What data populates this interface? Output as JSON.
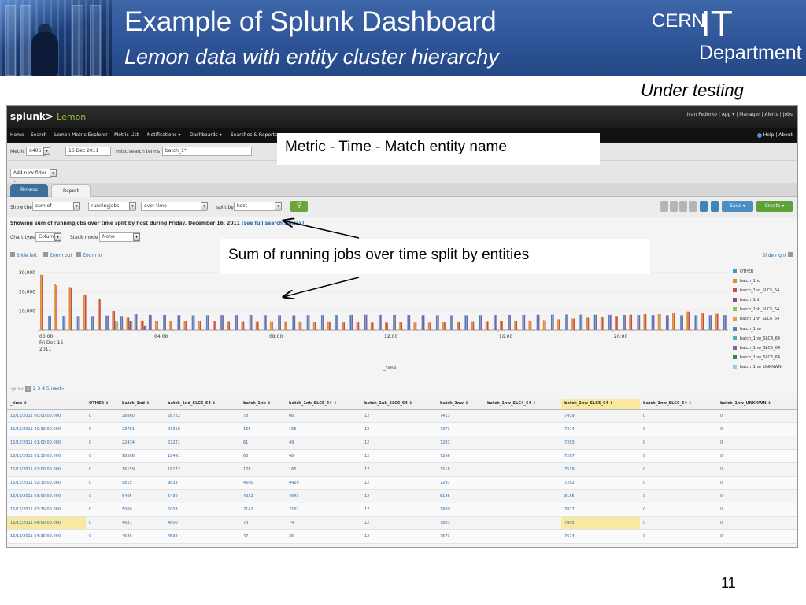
{
  "slide": {
    "title": "Example of Splunk Dashboard",
    "subtitle": "Lemon data with entity cluster hierarchy",
    "logo": {
      "cern": "CERN",
      "it": "IT",
      "dept": "Department"
    },
    "note": "Under testing",
    "page_number": "11"
  },
  "callouts": {
    "metric": "Metric - Time - Match entity name",
    "sum": "Sum of running jobs over time split by entities"
  },
  "app": {
    "brand": "splunk>",
    "app_name": "Lemon",
    "user_links": "Ivan Fedorko | App ▾ | Manager | Alerts | Jobs",
    "menu": [
      "Home",
      "Search",
      "Lemon Metric Explorer",
      "Metric List",
      "Notifications ▾",
      "Dashboards ▾",
      "Searches & Reports"
    ],
    "help_links": "Help | About",
    "search": {
      "metric_label": "Metric",
      "metric_value": "6406",
      "date_value": "16 Dec 2011",
      "misc_label": "misc search terms",
      "misc_value": "batch_1*"
    },
    "filter_button": "Add new filter ...",
    "tabs": {
      "browse": "Browse",
      "report": "Report"
    },
    "report": {
      "show_the_label": "Show the",
      "aggregate": "sum of",
      "field": "runningjobs",
      "over": "over time",
      "split_label": "split by",
      "split_value": "host",
      "save_label": "Save ▾",
      "create_label": "Create ▾"
    },
    "summary": "Showing sum of runningjobs over time split by host during Friday, December 16, 2011",
    "summary_link": "(see full search syntax)",
    "chart_type_label": "Chart type",
    "chart_type_value": "Column",
    "stack_mode_label": "Stack mode",
    "stack_mode_value": "None",
    "slide_left": "Slide left",
    "zoom_out": "Zoom out",
    "zoom_in": "Zoom in",
    "slide_right": "Slide right",
    "pager": {
      "prev": "«prev",
      "pages": [
        "1",
        "2",
        "3",
        "4",
        "5"
      ],
      "next": "next»"
    },
    "colors": {
      "topbar": "#1c1c1c",
      "accent": "#8fc33f",
      "link": "#2a6aa8",
      "tab": "#3e6e9c",
      "highlight": "#f8e8a0"
    }
  },
  "chart_data": {
    "type": "bar",
    "xlabel": "_time",
    "ylim": [
      0,
      32000
    ],
    "y_ticks": [
      "30,000",
      "20,000",
      "10,000"
    ],
    "y_tick_values": [
      30000,
      20000,
      10000
    ],
    "x_tick_labels": [
      {
        "label": "00:00",
        "sub": [
          "Fri Dec 16",
          "2011"
        ],
        "slot": 0
      },
      {
        "label": "04:00",
        "sub": [],
        "slot": 8
      },
      {
        "label": "08:00",
        "sub": [],
        "slot": 16
      },
      {
        "label": "12:00",
        "sub": [],
        "slot": 24
      },
      {
        "label": "16:00",
        "sub": [],
        "slot": 32
      },
      {
        "label": "20:00",
        "sub": [],
        "slot": 40
      }
    ],
    "slots": 48,
    "series": [
      {
        "name": "OTHER",
        "color": "#3f9fc0",
        "values": [
          0,
          0,
          0,
          0,
          0,
          0,
          0,
          0,
          0,
          0,
          0,
          0,
          0,
          0,
          0,
          0,
          0,
          0,
          0,
          0,
          0,
          0,
          0,
          0,
          0,
          0,
          0,
          0,
          0,
          0,
          0,
          0,
          0,
          0,
          0,
          0,
          0,
          0,
          0,
          0,
          0,
          0,
          0,
          0,
          0,
          0,
          0,
          0
        ]
      },
      {
        "name": "batch_1nd",
        "color": "#e38c2d",
        "values": [
          28860,
          23781,
          22434,
          18586,
          16159,
          9815,
          6405,
          5000,
          4681,
          4586,
          4700,
          4600,
          4500,
          4400,
          4350,
          4300,
          4300,
          4250,
          4200,
          4150,
          4200,
          4100,
          4100,
          4000,
          4000,
          4100,
          4050,
          4000,
          4100,
          4200,
          4300,
          4400,
          4600,
          4800,
          5000,
          5200,
          5600,
          6000,
          6400,
          7000,
          7300,
          8000,
          8200,
          8600,
          9000,
          9600,
          9000,
          8800
        ]
      },
      {
        "name": "batch_1nd_SLC5_64",
        "color": "#c0504d",
        "values": [
          28722,
          23310,
          22221,
          18491,
          16172,
          9833,
          6430,
          5003,
          4600,
          4532,
          4650,
          4550,
          4450,
          4350,
          4300,
          4250,
          4250,
          4200,
          4150,
          4100,
          4150,
          4050,
          4050,
          3950,
          3950,
          4050,
          4000,
          3950,
          4050,
          4150,
          4250,
          4350,
          4550,
          4750,
          4950,
          5150,
          5550,
          5950,
          6350,
          6950,
          7250,
          7950,
          8150,
          8550,
          8950,
          9550,
          8950,
          8750
        ]
      },
      {
        "name": "batch_1nh",
        "color": "#7b4f9d",
        "values": [
          78,
          166,
          61,
          60,
          178,
          4500,
          4932,
          2141,
          73,
          47,
          60,
          70,
          80,
          65,
          70,
          55,
          60,
          70,
          75,
          80,
          60,
          70,
          65,
          60,
          55,
          70,
          80,
          90,
          60,
          75,
          70,
          65,
          80,
          70,
          60,
          65,
          70,
          75,
          80,
          60,
          70,
          65,
          60,
          55,
          70,
          80,
          90,
          60
        ]
      },
      {
        "name": "batch_1nh_SLC5_64",
        "color": "#9bbb59",
        "values": [
          66,
          156,
          49,
          48,
          165,
          4420,
          4943,
          2161,
          74,
          35,
          50,
          60,
          70,
          55,
          60,
          45,
          50,
          60,
          65,
          70,
          50,
          60,
          55,
          50,
          45,
          60,
          70,
          80,
          50,
          65,
          60,
          55,
          70,
          60,
          50,
          55,
          60,
          65,
          70,
          50,
          60,
          55,
          50,
          45,
          60,
          70,
          80,
          50
        ]
      },
      {
        "name": "batch_1nh_SLC6_64",
        "color": "#f79646",
        "values": [
          12,
          12,
          12,
          12,
          12,
          12,
          12,
          12,
          12,
          12,
          12,
          12,
          12,
          12,
          12,
          12,
          12,
          12,
          12,
          12,
          12,
          12,
          12,
          12,
          12,
          12,
          12,
          12,
          12,
          12,
          12,
          12,
          12,
          12,
          12,
          12,
          12,
          12,
          12,
          12,
          12,
          12,
          12,
          12,
          12,
          12,
          12,
          12
        ]
      },
      {
        "name": "batch_1nw",
        "color": "#4f81bd",
        "values": [
          7413,
          7372,
          7283,
          7266,
          7518,
          7291,
          8186,
          7809,
          7803,
          7673,
          7600,
          7650,
          7700,
          7750,
          7800,
          7700,
          7650,
          7600,
          7700,
          7750,
          7800,
          7850,
          7900,
          7850,
          7800,
          7750,
          7700,
          7650,
          7600,
          7650,
          7700,
          7750,
          7800,
          7850,
          7900,
          7950,
          8000,
          7950,
          7900,
          7850,
          7800,
          7750,
          7700,
          7650,
          7600,
          7650,
          7700,
          7750
        ]
      },
      {
        "name": "batch_1nw_SLC4_64",
        "color": "#4bacc6",
        "values": [
          0,
          0,
          0,
          0,
          0,
          0,
          0,
          0,
          0,
          0,
          0,
          0,
          0,
          0,
          0,
          0,
          0,
          0,
          0,
          0,
          0,
          0,
          0,
          0,
          0,
          0,
          0,
          0,
          0,
          0,
          0,
          0,
          0,
          0,
          0,
          0,
          0,
          0,
          0,
          0,
          0,
          0,
          0,
          0,
          0,
          0,
          0,
          0
        ]
      },
      {
        "name": "batch_1nw_SLC5_64",
        "color": "#8064a2",
        "values": [
          7419,
          7374,
          7283,
          7267,
          7519,
          7282,
          8185,
          7817,
          7805,
          7674,
          7600,
          7650,
          7700,
          7750,
          7800,
          7700,
          7650,
          7600,
          7700,
          7750,
          7800,
          7850,
          7900,
          7850,
          7800,
          7750,
          7700,
          7650,
          7600,
          7650,
          7700,
          7750,
          7800,
          7850,
          7900,
          7950,
          8000,
          7950,
          7900,
          7850,
          7800,
          7750,
          7700,
          7650,
          7600,
          7650,
          7700,
          7750
        ]
      },
      {
        "name": "batch_1nw_SLC6_64",
        "color": "#2c8a4a",
        "values": [
          0,
          0,
          0,
          0,
          0,
          0,
          0,
          0,
          0,
          0,
          0,
          0,
          0,
          0,
          0,
          0,
          0,
          0,
          0,
          0,
          0,
          0,
          0,
          0,
          0,
          0,
          0,
          0,
          0,
          0,
          0,
          0,
          0,
          0,
          0,
          0,
          0,
          0,
          0,
          0,
          0,
          0,
          0,
          0,
          0,
          0,
          0,
          0
        ]
      },
      {
        "name": "batch_1nw_UNKNWN",
        "color": "#93cddd",
        "values": [
          0,
          0,
          0,
          0,
          0,
          0,
          0,
          0,
          0,
          0,
          0,
          0,
          0,
          0,
          0,
          0,
          0,
          0,
          0,
          0,
          0,
          0,
          0,
          0,
          0,
          0,
          0,
          0,
          0,
          0,
          0,
          0,
          0,
          0,
          0,
          0,
          0,
          0,
          0,
          0,
          0,
          0,
          0,
          0,
          0,
          0,
          0,
          0
        ]
      }
    ]
  },
  "table": {
    "columns": [
      "_time ↕",
      "OTHER ↕",
      "batch_1nd ↕",
      "batch_1nd_SLC5_64 ↕",
      "batch_1nh ↕",
      "batch_1nh_SLC5_64 ↕",
      "batch_1nh_SLC6_64 ↕",
      "batch_1nw ↕",
      "batch_1nw_SLC4_64 ↕",
      "batch_1nw_SLC5_64 ↕",
      "batch_1nw_SLC6_64 ↕",
      "batch_1nw_UNKNWN ↕"
    ],
    "highlight_col": 9,
    "highlight_row": 8,
    "rows": [
      [
        "16/12/2011 00:00:00.000",
        "0",
        "28860",
        "28722",
        "78",
        "66",
        "12",
        "7413",
        "",
        "7419",
        "0",
        "0"
      ],
      [
        "16/12/2011 00:30:00.000",
        "0",
        "23781",
        "23310",
        "166",
        "156",
        "12",
        "7372",
        "",
        "7374",
        "0",
        "0"
      ],
      [
        "16/12/2011 01:00:00.000",
        "0",
        "22434",
        "22221",
        "61",
        "49",
        "12",
        "7283",
        "",
        "7283",
        "0",
        "0"
      ],
      [
        "16/12/2011 01:30:00.000",
        "0",
        "18586",
        "18491",
        "60",
        "48",
        "12",
        "7266",
        "",
        "7267",
        "0",
        "0"
      ],
      [
        "16/12/2011 02:00:00.000",
        "0",
        "16159",
        "16172",
        "178",
        "165",
        "12",
        "7518",
        "",
        "7519",
        "0",
        "0"
      ],
      [
        "16/12/2011 02:30:00.000",
        "0",
        "9815",
        "9833",
        "4500",
        "4420",
        "12",
        "7291",
        "",
        "7282",
        "0",
        "0"
      ],
      [
        "16/12/2011 03:00:00.000",
        "0",
        "6405",
        "6430",
        "4932",
        "4943",
        "12",
        "8186",
        "",
        "8185",
        "0",
        "0"
      ],
      [
        "16/12/2011 03:30:00.000",
        "0",
        "5000",
        "5003",
        "2141",
        "2161",
        "12",
        "7809",
        "",
        "7817",
        "0",
        "0"
      ],
      [
        "16/12/2011 04:00:00.000",
        "0",
        "4681",
        "4600",
        "73",
        "74",
        "12",
        "7803",
        "",
        "7805",
        "0",
        "0"
      ],
      [
        "16/12/2011 04:30:00.000",
        "0",
        "4586",
        "4532",
        "47",
        "35",
        "12",
        "7673",
        "",
        "7674",
        "0",
        "0"
      ]
    ]
  }
}
